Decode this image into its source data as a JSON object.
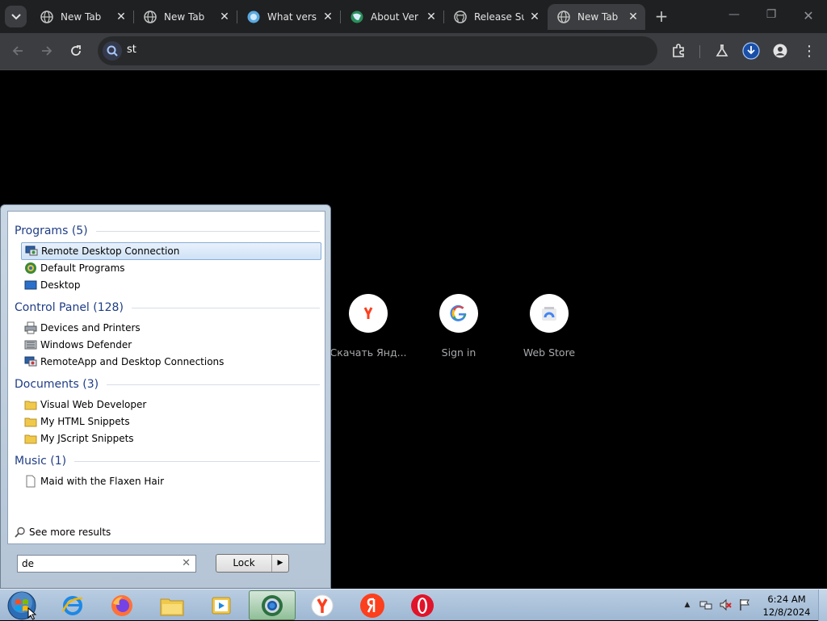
{
  "browser": {
    "tabs": [
      {
        "title": "New Tab",
        "favicon": "globe-icon",
        "active": false
      },
      {
        "title": "New Tab",
        "favicon": "globe-icon",
        "active": false
      },
      {
        "title": "What versi",
        "favicon": "blue-globe-icon",
        "active": false
      },
      {
        "title": "About Ver",
        "favicon": "chrome-globe-icon",
        "active": false
      },
      {
        "title": "Release Su",
        "favicon": "github-icon",
        "active": false
      },
      {
        "title": "New Tab",
        "favicon": "globe-icon",
        "active": true
      }
    ],
    "omnibox_text": "st",
    "shortcuts": [
      {
        "label": "Скачать Янд...",
        "icon": "yandex-icon"
      },
      {
        "label": "Sign in",
        "icon": "google-icon"
      },
      {
        "label": "Web Store",
        "icon": "webstore-icon"
      }
    ]
  },
  "start_menu": {
    "sections": [
      {
        "heading": "Programs (5)",
        "items": [
          "Remote Desktop Connection",
          "Default Programs",
          "Desktop"
        ]
      },
      {
        "heading": "Control Panel (128)",
        "items": [
          "Devices and Printers",
          "Windows Defender",
          "RemoteApp and Desktop Connections"
        ]
      },
      {
        "heading": "Documents (3)",
        "items": [
          "Visual Web Developer",
          "My HTML Snippets",
          "My JScript Snippets"
        ]
      },
      {
        "heading": "Music (1)",
        "items": [
          "Maid with the Flaxen Hair"
        ]
      }
    ],
    "see_more": "See more results",
    "search_value": "de",
    "lock_label": "Lock"
  },
  "taskbar": {
    "apps": [
      "internet-explorer-icon",
      "firefox-icon",
      "file-explorer-icon",
      "media-player-icon",
      "chrome-icon",
      "yandex-browser-icon",
      "yandex-icon",
      "opera-icon"
    ],
    "time": "6:24 AM",
    "date": "12/8/2024"
  },
  "colors": {
    "tab_bar": "#1f2022",
    "toolbar": "#3c3d40",
    "selection": "#cfe2f6",
    "taskbar": "#a9c1da"
  }
}
